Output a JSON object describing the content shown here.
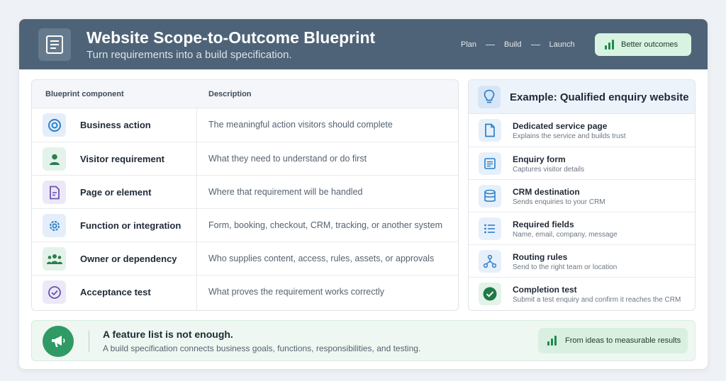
{
  "colors": {
    "header_bg": "#4e6377",
    "accent_green": "#2f9a63",
    "badge_green_bg": "#d9f3e2",
    "accent_blue": "#2d7fc8"
  },
  "header": {
    "icon": "document-icon",
    "title": "Website Scope-to-Outcome Blueprint",
    "subtitle": "Turn requirements into a build specification.",
    "steps": [
      "Plan",
      "Build",
      "Launch"
    ],
    "badge_icon": "bar-chart-icon",
    "badge_label": "Better outcomes"
  },
  "table": {
    "col1": "Blueprint component",
    "col2": "Description",
    "rows": [
      {
        "icon": "target-icon",
        "name": "Business action",
        "desc": "The meaningful action visitors should complete"
      },
      {
        "icon": "user-icon",
        "name": "Visitor requirement",
        "desc": "What they need to understand or do first"
      },
      {
        "icon": "page-icon",
        "name": "Page or element",
        "desc": "Where that requirement will be handled"
      },
      {
        "icon": "gear-icon",
        "name": "Function or integration",
        "desc": "Form, booking, checkout, CRM, tracking, or another system"
      },
      {
        "icon": "team-icon",
        "name": "Owner or dependency",
        "desc": "Who supplies content, access, rules, assets, or approvals"
      },
      {
        "icon": "check-circle-icon",
        "name": "Acceptance test",
        "desc": "What proves the requirement works correctly"
      }
    ]
  },
  "example": {
    "icon": "lightbulb-icon",
    "title": "Example: Qualified enquiry website",
    "items": [
      {
        "icon": "file-icon",
        "title": "Dedicated service page",
        "sub": "Explains the service and builds trust"
      },
      {
        "icon": "form-icon",
        "title": "Enquiry form",
        "sub": "Captures visitor details"
      },
      {
        "icon": "database-icon",
        "title": "CRM destination",
        "sub": "Sends enquiries to your CRM"
      },
      {
        "icon": "list-icon",
        "title": "Required fields",
        "sub": "Name, email, company, message"
      },
      {
        "icon": "routing-icon",
        "title": "Routing rules",
        "sub": "Send to the right team or location"
      },
      {
        "icon": "check-circle-icon",
        "title": "Completion test",
        "sub": "Submit a test enquiry and confirm it reaches the CRM"
      }
    ]
  },
  "footer": {
    "icon": "megaphone-icon",
    "title": "A feature list is not enough.",
    "subtitle": "A build specification connects business goals, functions, responsibilities, and testing.",
    "badge_icon": "bar-chart-icon",
    "badge_label": "From ideas to measurable results"
  }
}
